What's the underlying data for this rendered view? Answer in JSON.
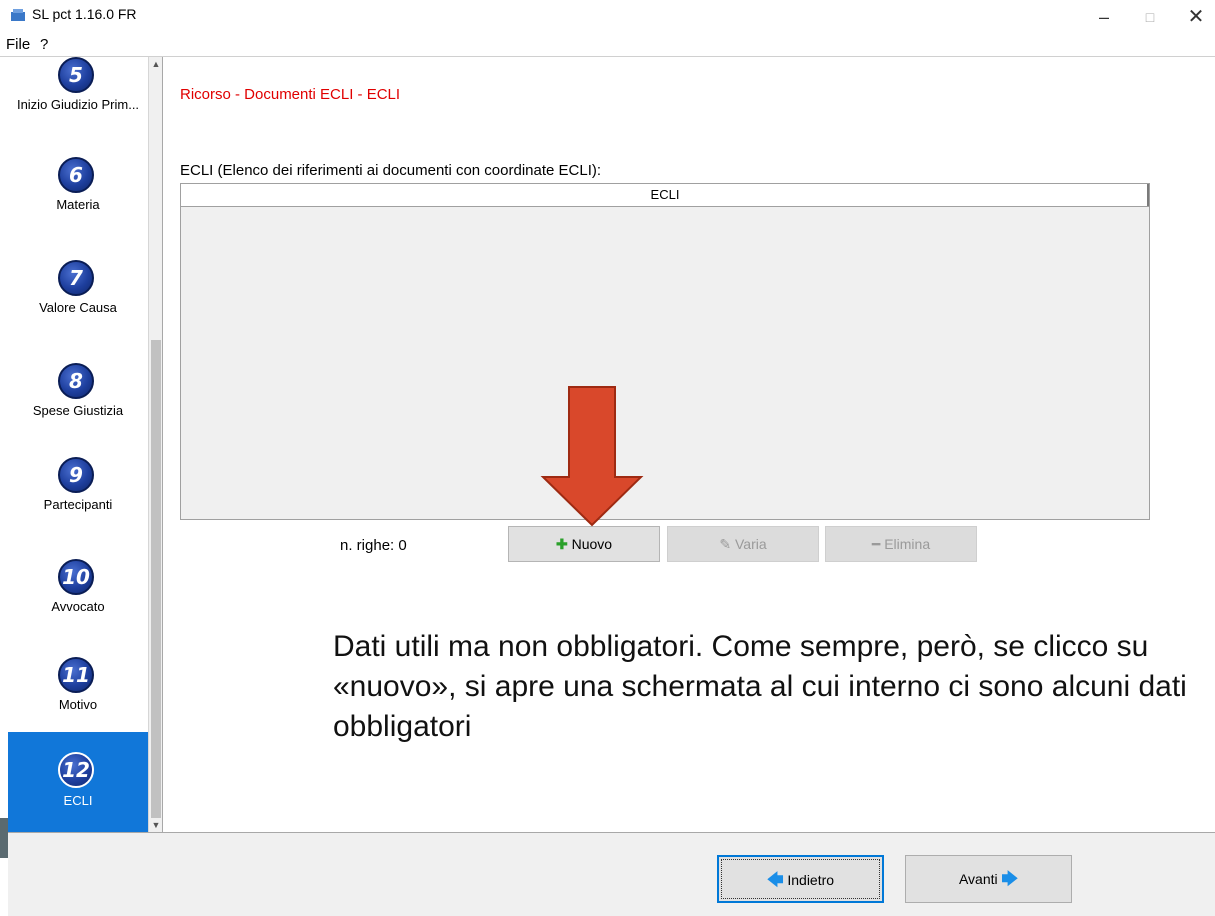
{
  "window": {
    "title": "SL pct 1.16.0 FR",
    "minimize": "–",
    "maximize": "□",
    "close": "✕"
  },
  "menu": {
    "file": "File",
    "help": "?"
  },
  "steps": [
    {
      "number": "5",
      "label": "Inizio Giudizio Prim..."
    },
    {
      "number": "6",
      "label": "Materia"
    },
    {
      "number": "7",
      "label": "Valore Causa"
    },
    {
      "number": "8",
      "label": "Spese Giustizia"
    },
    {
      "number": "9",
      "label": "Partecipanti"
    },
    {
      "number": "10",
      "label": "Avvocato"
    },
    {
      "number": "11",
      "label": "Motivo"
    },
    {
      "number": "12",
      "label": "ECLI"
    }
  ],
  "main": {
    "title": "Ricorso - Documenti ECLI - ECLI",
    "table_caption": "ECLI (Elenco dei riferimenti ai documenti con coordinate ECLI):",
    "table_header": "ECLI",
    "row_count": "n. righe: 0",
    "buttons": {
      "new": "Nuovo",
      "edit": "Varia",
      "delete": "Elimina"
    }
  },
  "note": "Dati utili ma non obbligatori. Come sempre, però, se clicco su «nuovo», si apre una schermata al cui interno ci sono alcuni dati obbligatori",
  "footer": {
    "back": "Indietro",
    "next": "Avanti"
  },
  "colors": {
    "accent": "#1177d9",
    "title_red": "#e00000",
    "arrow": "#d9482b"
  }
}
